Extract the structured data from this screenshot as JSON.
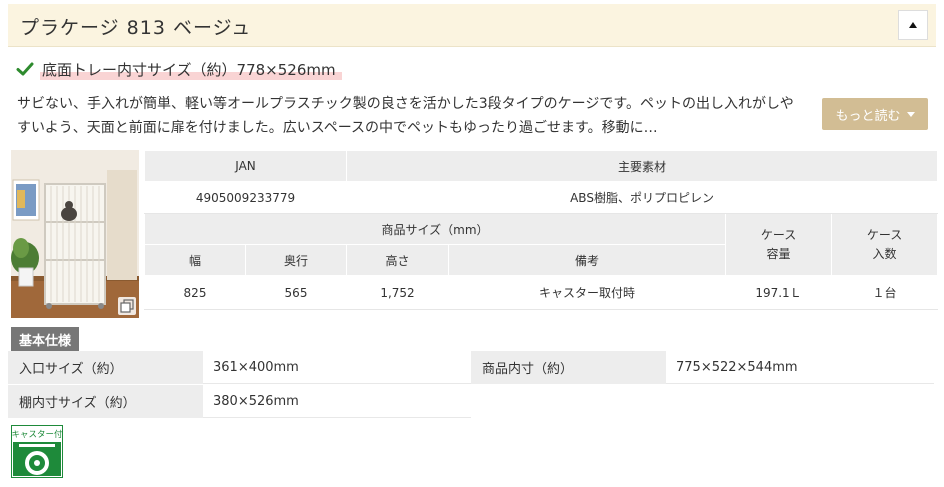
{
  "title": "プラケージ 813 ベージュ",
  "feature": "底面トレー内寸サイズ（約）778×526mm",
  "description": "サビない、手入れが簡単、軽い等オールプラスチック製の良さを活かした3段タイプのケージです。ペットの出し入れがしやすいよう、天面と前面に扉を付けました。広いスペースの中でペットもゆったり過ごせます。移動に…",
  "more_button": "もっと読む",
  "spec": {
    "jan_header": "JAN",
    "material_header": "主要素材",
    "jan_value": "4905009233779",
    "material_value": "ABS樹脂、ポリプロピレン",
    "size_header": "商品サイズ（mm）",
    "case_capacity_header": "ケース\n容量",
    "case_count_header": "ケース\n入数",
    "width_header": "幅",
    "depth_header": "奥行",
    "height_header": "高さ",
    "note_header": "備考",
    "width_value": "825",
    "depth_value": "565",
    "height_value": "1,752",
    "note_value": "キャスター取付時",
    "case_capacity_value": "197.1Ｌ",
    "case_count_value": "１台"
  },
  "basic": {
    "section_label": "基本仕様",
    "entrance_label": "入口サイズ（約）",
    "entrance_value": "361×400mm",
    "inner_label": "商品内寸（約）",
    "inner_value": "775×522×544mm",
    "shelf_label": "棚内寸サイズ（約）",
    "shelf_value": "380×526mm"
  },
  "caster_icon_label": "キャスター付",
  "colors": {
    "title_bg": "#fbf4e0",
    "check": "#2e8b2e",
    "highlight": "#f9d4d4",
    "more_btn": "#d2bd94",
    "table_header": "#ededed",
    "section_label": "#777777",
    "caster_green": "#1e8a3a"
  }
}
